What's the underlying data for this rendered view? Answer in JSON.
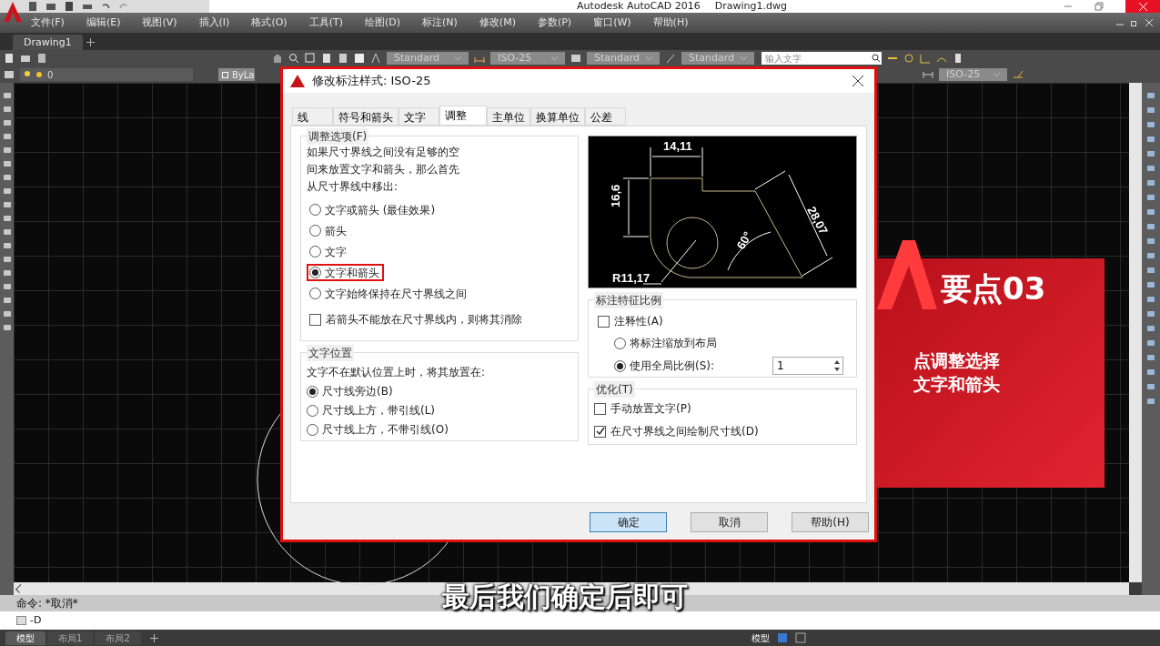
{
  "title_bar": {
    "app_name": "Autodesk AutoCAD 2016",
    "file_name": "Drawing1.dwg"
  },
  "menu": [
    "文件(F)",
    "编辑(E)",
    "视图(V)",
    "插入(I)",
    "格式(O)",
    "工具(T)",
    "绘图(D)",
    "标注(N)",
    "修改(M)",
    "参数(P)",
    "窗口(W)",
    "帮助(H)"
  ],
  "doc_tabs": [
    {
      "label": "Drawing1",
      "selected": true
    }
  ],
  "toolbar": {
    "text_style": "Standard",
    "dim_style": "ISO-25",
    "table_style": "Standard",
    "mleader_style": "Standard",
    "search_placeholder": "输入文字",
    "layer": "0",
    "color_control": "ByLa",
    "dim_style_2": "ISO-25"
  },
  "dialog": {
    "title": "修改标注样式: ISO-25",
    "tabs": [
      {
        "label": "线",
        "selected": false
      },
      {
        "label": "符号和箭头",
        "selected": false
      },
      {
        "label": "文字",
        "selected": false
      },
      {
        "label": "调整",
        "selected": true
      },
      {
        "label": "主单位",
        "selected": false
      },
      {
        "label": "换算单位",
        "selected": false
      },
      {
        "label": "公差",
        "selected": false
      }
    ],
    "fit_options": {
      "legend": "调整选项(F)",
      "description_lines": [
        "如果尺寸界线之间没有足够的空",
        "间来放置文字和箭头，那么首先",
        "从尺寸界线中移出:"
      ],
      "options": [
        {
          "label": "文字或箭头 (最佳效果)",
          "selected": false,
          "highlighted": false
        },
        {
          "label": "箭头",
          "selected": false,
          "highlighted": false
        },
        {
          "label": "文字",
          "selected": false,
          "highlighted": false
        },
        {
          "label": "文字和箭头",
          "selected": true,
          "highlighted": true
        },
        {
          "label": "文字始终保持在尺寸界线之间",
          "selected": false,
          "highlighted": false
        }
      ],
      "suppress": {
        "label": "若箭头不能放在尺寸界线内，则将其消除",
        "checked": false
      }
    },
    "text_placement": {
      "legend": "文字位置",
      "description": "文字不在默认位置上时，将其放置在:",
      "options": [
        {
          "label": "尺寸线旁边(B)",
          "selected": true
        },
        {
          "label": "尺寸线上方，带引线(L)",
          "selected": false
        },
        {
          "label": "尺寸线上方，不带引线(O)",
          "selected": false
        }
      ]
    },
    "preview": {
      "labels": [
        "14,11",
        "16,6",
        "28,07",
        "60°",
        "R11,17"
      ]
    },
    "scale": {
      "legend": "标注特征比例",
      "annotative": {
        "label": "注释性(A)",
        "checked": false
      },
      "options": [
        {
          "label": "将标注缩放到布局",
          "selected": false
        },
        {
          "label": "使用全局比例(S):",
          "selected": true
        }
      ],
      "value": "1"
    },
    "fine_tuning": {
      "legend": "优化(T)",
      "checks": [
        {
          "label": "手动放置文字(P)",
          "checked": false
        },
        {
          "label": "在尺寸界线之间绘制尺寸线(D)",
          "checked": true
        }
      ]
    },
    "buttons": [
      {
        "label": "确定",
        "default": true
      },
      {
        "label": "取消",
        "default": false
      },
      {
        "label": "帮助(H)",
        "default": false
      }
    ]
  },
  "command": {
    "history": "命令: *取消*",
    "input": "-D"
  },
  "layout_tabs": [
    {
      "label": "模型",
      "selected": true
    },
    {
      "label": "布局1",
      "selected": false
    },
    {
      "label": "布局2",
      "selected": false
    }
  ],
  "status_bar": {
    "space": "模型"
  },
  "tip_card": {
    "title": "要点03",
    "lines": [
      "点调整选择",
      "文字和箭头"
    ]
  },
  "subtitle": "最后我们确定后即可"
}
